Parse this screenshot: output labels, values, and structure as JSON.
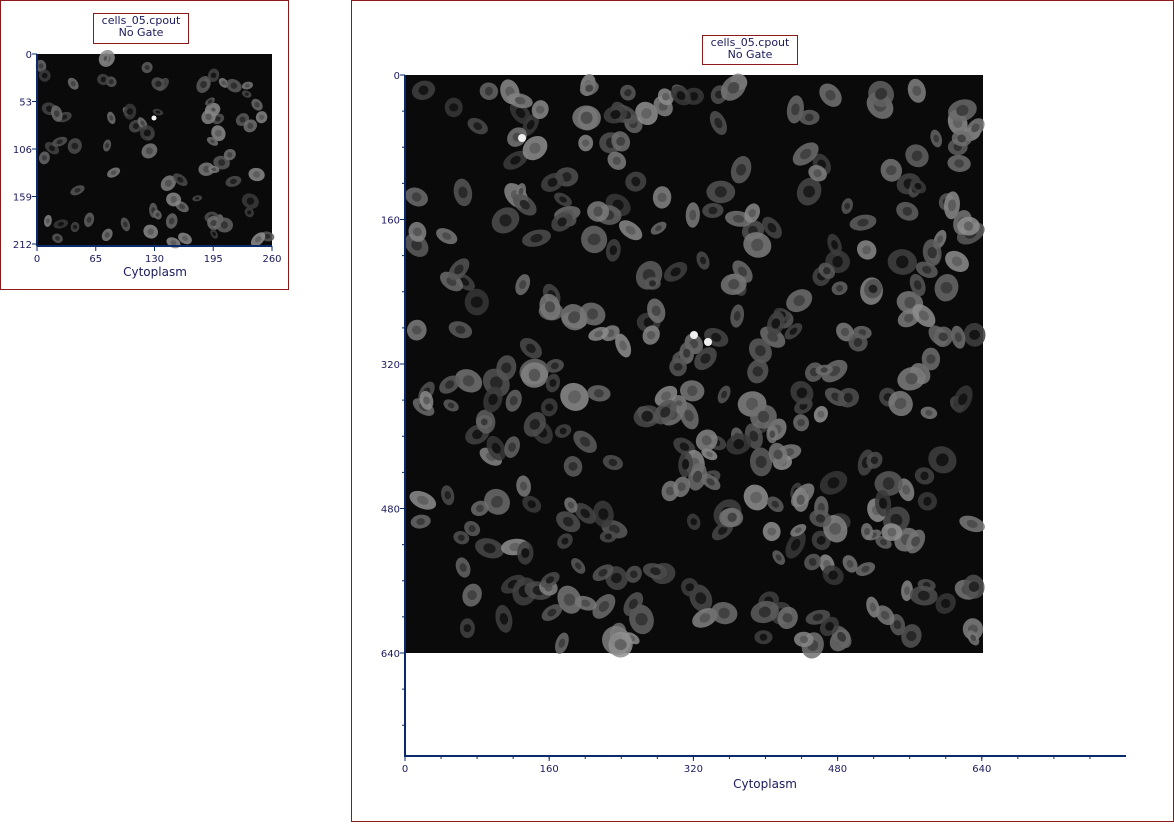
{
  "plots": [
    {
      "id": "small",
      "legend": {
        "file": "cells_05.cpout",
        "gate": "No Gate"
      },
      "x_axis": {
        "label": "Cytoplasm",
        "ticks": [
          "0",
          "65",
          "130",
          "195",
          "260"
        ]
      },
      "y_axis": {
        "ticks": [
          "0",
          "53",
          "106",
          "159",
          "212"
        ]
      }
    },
    {
      "id": "large",
      "legend": {
        "file": "cells_05.cpout",
        "gate": "No Gate"
      },
      "x_axis": {
        "label": "Cytoplasm",
        "ticks": [
          "0",
          "160",
          "320",
          "480",
          "640"
        ]
      },
      "y_axis": {
        "ticks": [
          "0",
          "160",
          "320",
          "480",
          "640"
        ]
      }
    }
  ],
  "colors": {
    "panel_border": "#8b1a1a",
    "axis": "#0a2a6a",
    "text": "#1a1a5e",
    "image_background": "#0a0a0a"
  }
}
